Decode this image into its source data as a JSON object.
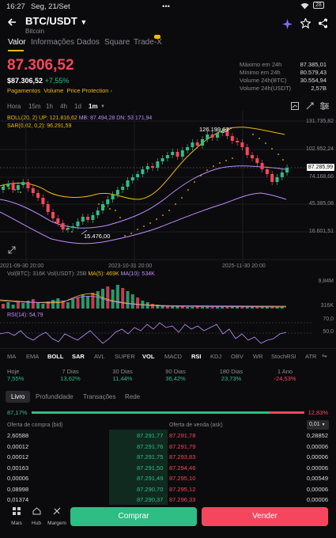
{
  "status_bar": {
    "time": "16:27",
    "date": "Seg, 21/Set",
    "dots": "•••",
    "battery": "28"
  },
  "header": {
    "pair": "BTC/USDT",
    "name": "Bitcoin",
    "back_icon": "arrow-left-icon",
    "dropdown_icon": "caret-down-icon",
    "icons": [
      "sparkle-icon",
      "star-icon",
      "share-icon"
    ]
  },
  "tabs": [
    {
      "label": "Valor",
      "active": true
    },
    {
      "label": "Informações",
      "active": false
    },
    {
      "label": "Dados",
      "active": false
    },
    {
      "label": "Square",
      "active": false
    },
    {
      "label": "Trade-X",
      "active": false
    }
  ],
  "price": {
    "main": "87.306,52",
    "sub": "$87.306,52",
    "change": "+7,55%",
    "tags": [
      "Pagamentos",
      "Volume",
      "Price Protection"
    ]
  },
  "stats": [
    {
      "label": "Máximo em 24h",
      "value": "87.385,01"
    },
    {
      "label": "Mínimo em 24h",
      "value": "80.579,43"
    },
    {
      "label": "Volume 24h(BTC)",
      "value": "30.554,94"
    },
    {
      "label": "Volume 24h(USDT)",
      "value": "2,57B"
    }
  ],
  "timeframes": [
    {
      "label": "Hora",
      "active": false
    },
    {
      "label": "15m",
      "active": false
    },
    {
      "label": "1h",
      "active": false
    },
    {
      "label": "4h",
      "active": false
    },
    {
      "label": "1d",
      "active": false
    },
    {
      "label": "1m",
      "active": true
    }
  ],
  "chart_legend": {
    "boll": "BOLL(20, 2)",
    "up": "UP: 121.816,62",
    "mb": "MB: 87.494,28",
    "dn": "DN: 53.171,94",
    "sar": "SAR(0,02, 0,2): 96.291,59"
  },
  "price_axis": [
    "131.735,82",
    "102.952,24",
    "74.168,66",
    "45.385,08",
    "16.601,51"
  ],
  "current_price_tag": "87.285,99",
  "annotations": {
    "high": "126.199,63",
    "low": "15.476,00"
  },
  "date_axis": [
    "2021-09-30 20:00",
    "2023-10-31 20:00",
    "2025-11-30 20:00"
  ],
  "volume_legend": {
    "vol_btc": "Vol(BTC): 316K",
    "vol_usdt": "Vol(USDT): 25B",
    "ma5": "MA(5): 469K",
    "ma10": "MA(10): 534K"
  },
  "volume_axis": [
    "9,84M",
    "316K"
  ],
  "rsi_legend": "RSI(14): 54,79",
  "rsi_axis": [
    "70,0",
    "50,0"
  ],
  "indicators": [
    {
      "label": "MA",
      "active": false
    },
    {
      "label": "EMA",
      "active": false
    },
    {
      "label": "BOLL",
      "active": true
    },
    {
      "label": "SAR",
      "active": true
    },
    {
      "label": "AVL",
      "active": false
    },
    {
      "label": "SUPER",
      "active": false
    },
    {
      "label": "VOL",
      "active": true
    },
    {
      "label": "MACD",
      "active": false
    },
    {
      "label": "RSI",
      "active": true
    },
    {
      "label": "KDJ",
      "active": false
    },
    {
      "label": "OBV",
      "active": false
    },
    {
      "label": "WR",
      "active": false
    },
    {
      "label": "StochRSI",
      "active": false
    },
    {
      "label": "ATR",
      "active": false
    }
  ],
  "performance": [
    {
      "label": "Hoje",
      "value": "7,55%",
      "color": "green"
    },
    {
      "label": "7 Dias",
      "value": "13,62%",
      "color": "green"
    },
    {
      "label": "30 Dias",
      "value": "11,44%",
      "color": "green"
    },
    {
      "label": "90 Dias",
      "value": "36,42%",
      "color": "green"
    },
    {
      "label": "180 Dias",
      "value": "23,73%",
      "color": "green"
    },
    {
      "label": "1 Ano",
      "value": "-24,53%",
      "color": "red"
    }
  ],
  "book_tabs": [
    {
      "label": "Livro",
      "active": true
    },
    {
      "label": "Profundidade",
      "active": false
    },
    {
      "label": "Transações",
      "active": false
    },
    {
      "label": "Rede",
      "active": false
    }
  ],
  "ratio": {
    "bid": "87,17%",
    "ask": "12,83%",
    "bid_fraction": 0.8717
  },
  "book_headers": {
    "bid": "Oferta de compra (bid)",
    "ask": "Oferta de venda (ask)",
    "precision": "0,01"
  },
  "order_book": [
    {
      "bid_qty": "2,60588",
      "bid_price": "87.291,77",
      "ask_price": "87.291,78",
      "ask_qty": "0,28852"
    },
    {
      "bid_qty": "0,00012",
      "bid_price": "87.291,76",
      "ask_price": "87.291,79",
      "ask_qty": "0,00006"
    },
    {
      "bid_qty": "0,00012",
      "bid_price": "87.291,75",
      "ask_price": "87.293,83",
      "ask_qty": "0,00006"
    },
    {
      "bid_qty": "0,00163",
      "bid_price": "87.291,50",
      "ask_price": "87.294,46",
      "ask_qty": "0,00006"
    },
    {
      "bid_qty": "0,00006",
      "bid_price": "87.291,49",
      "ask_price": "87.295,10",
      "ask_qty": "0,00549"
    },
    {
      "bid_qty": "0,08998",
      "bid_price": "87.290,70",
      "ask_price": "87.295,12",
      "ask_qty": "0,00006"
    },
    {
      "bid_qty": "0,01374",
      "bid_price": "87.290,37",
      "ask_price": "87.296,33",
      "ask_qty": "0,00006"
    }
  ],
  "bottom_nav": [
    {
      "label": "Mais",
      "icon": "grid-icon"
    },
    {
      "label": "Hub",
      "icon": "hub-icon"
    },
    {
      "label": "Margem",
      "icon": "margin-icon"
    }
  ],
  "actions": {
    "buy": "Comprar",
    "sell": "Vender"
  },
  "colors": {
    "green": "#2ebd85",
    "red": "#f6465d",
    "yellow": "#f0b90b",
    "purple": "#c08bff",
    "background": "#0b0b0d"
  }
}
